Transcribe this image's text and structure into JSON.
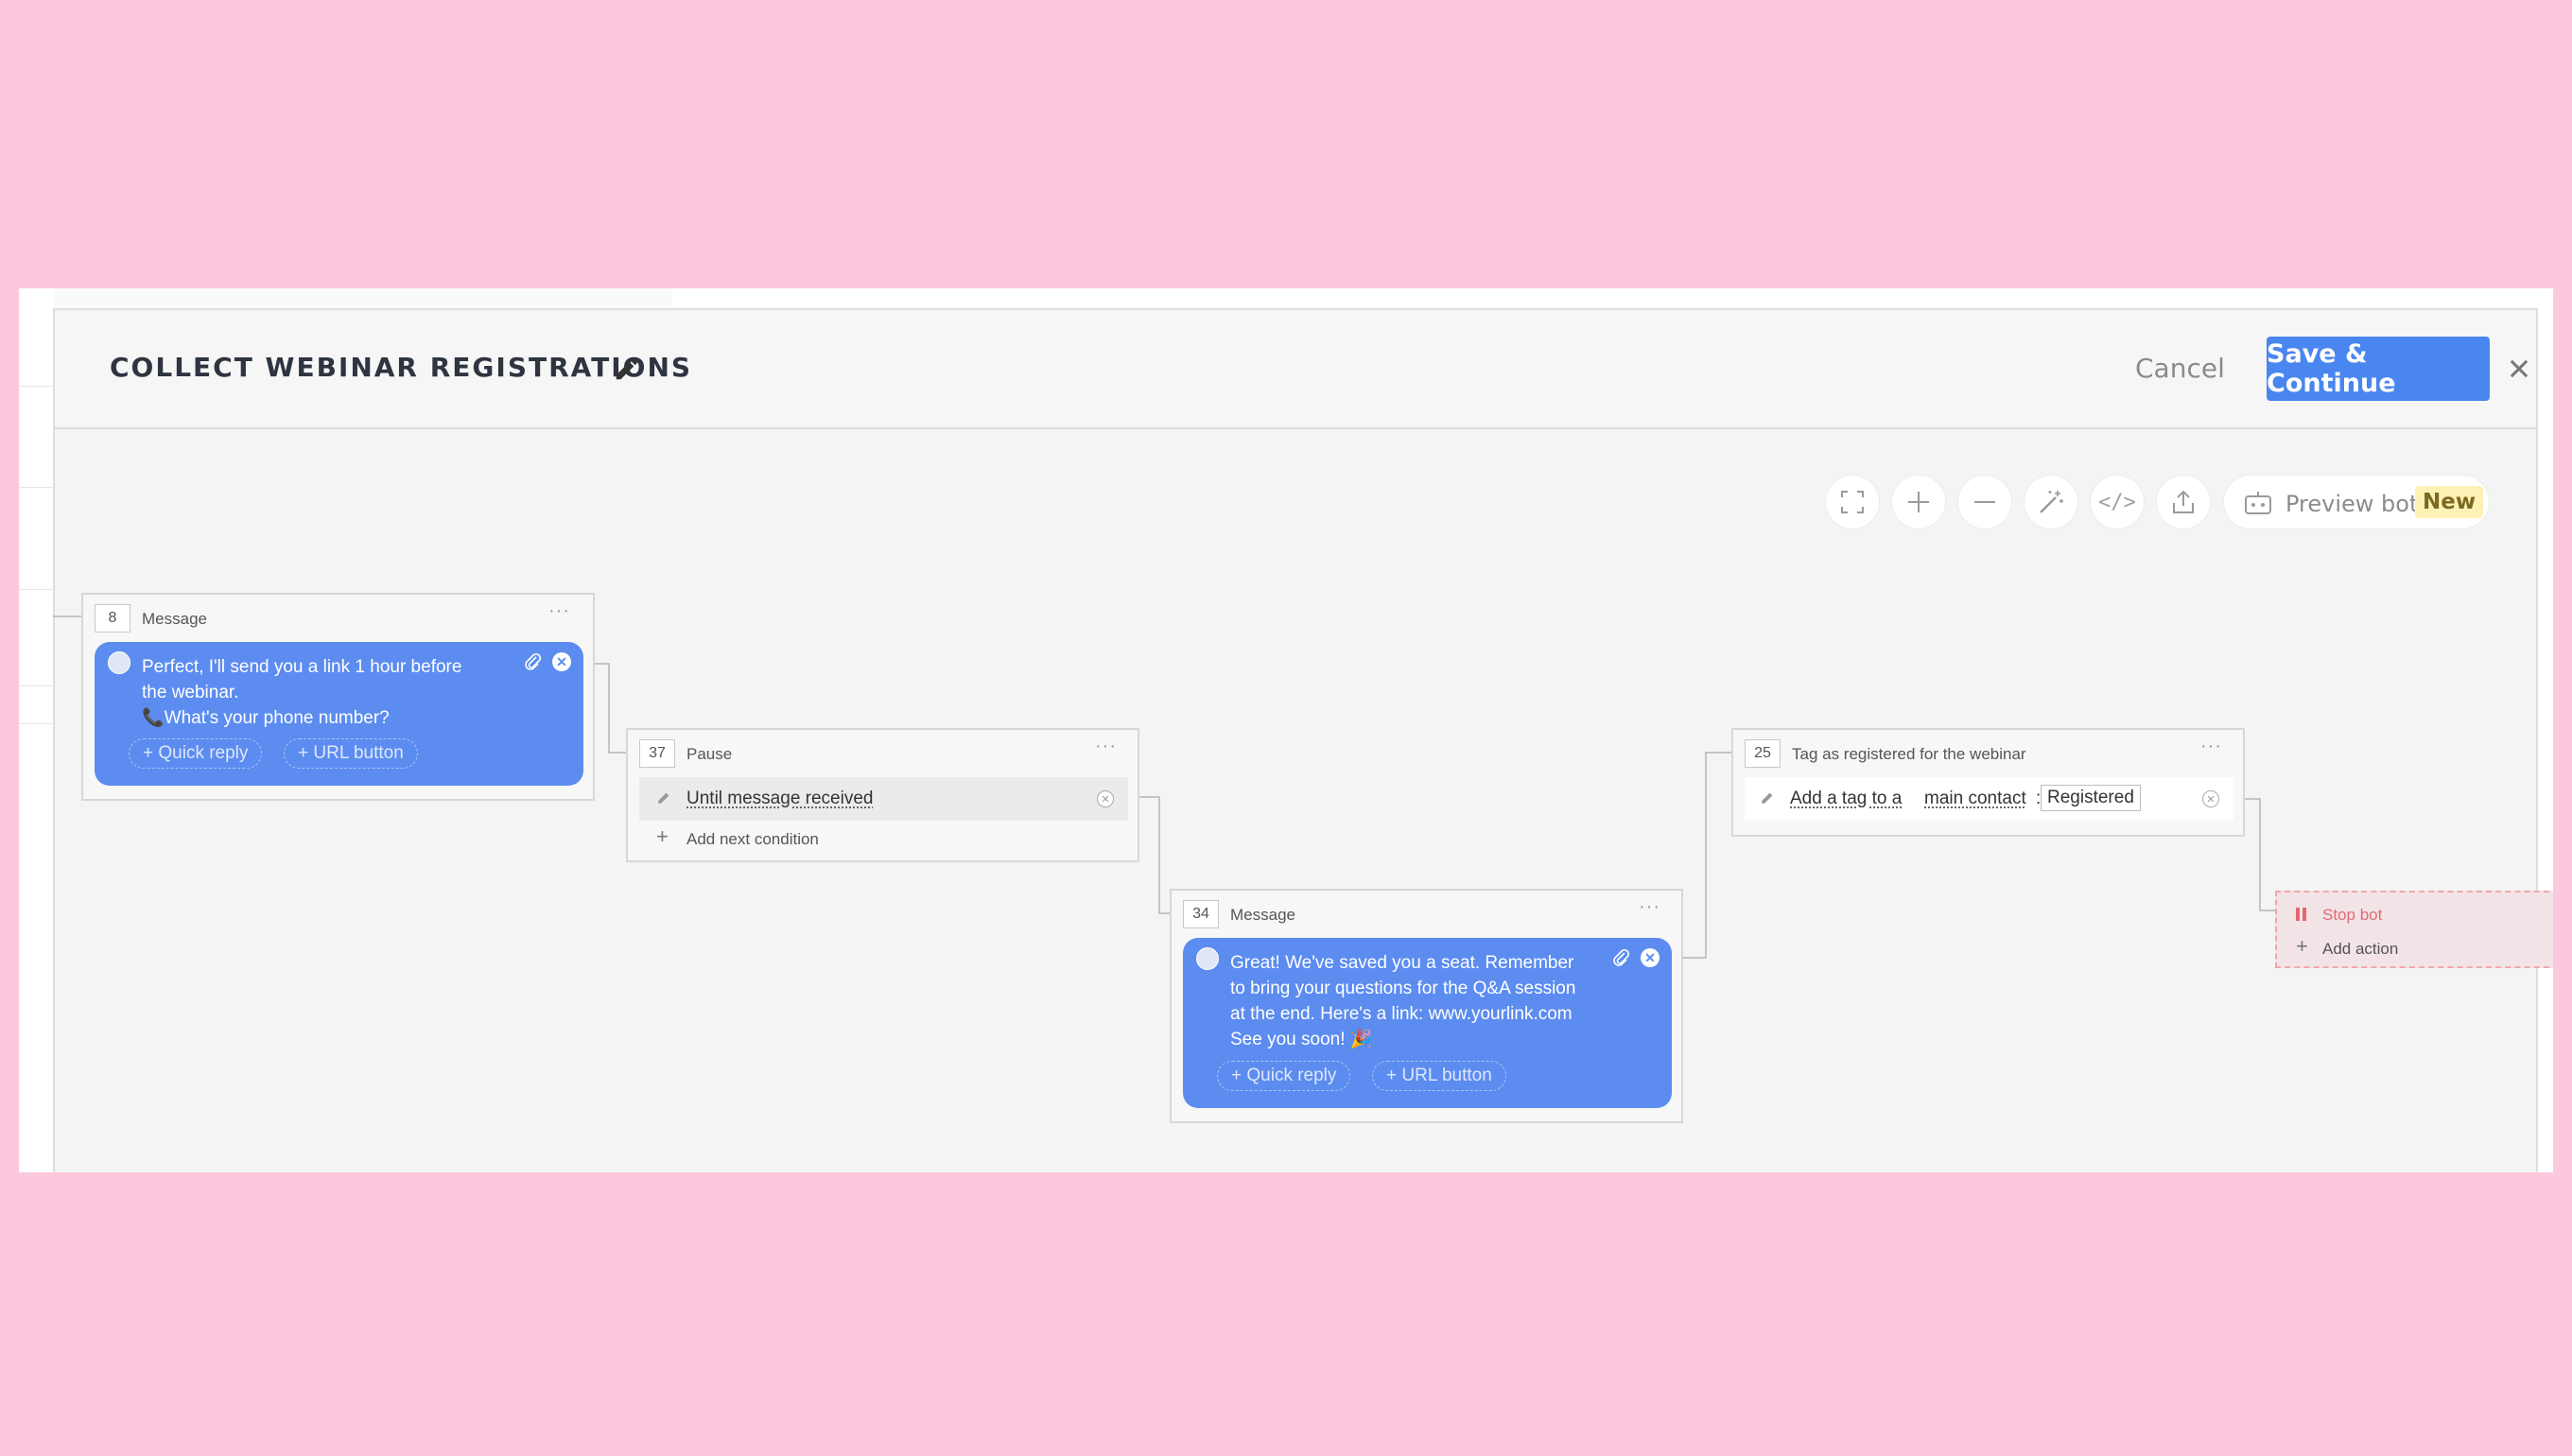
{
  "header": {
    "title": "COLLECT WEBINAR REGISTRATIONS",
    "cancel_label": "Cancel",
    "save_label": "Save & Continue"
  },
  "toolbar": {
    "tools": [
      "fullscreen-icon",
      "zoom-in-icon",
      "zoom-out-icon",
      "magic-wand-icon",
      "code-icon",
      "export-icon"
    ],
    "code_glyph": "</>",
    "preview_label": "Preview bot",
    "new_badge": "New"
  },
  "nodes": {
    "message1": {
      "number": "8",
      "type": "Message",
      "text": "Perfect, I'll send you a link 1 hour before\nthe webinar.\n📞What's your phone number?",
      "quick_reply": "+ Quick reply",
      "url_button": "+ URL button"
    },
    "pause": {
      "number": "37",
      "type": "Pause",
      "condition": "Until message received",
      "add_condition": "Add next condition"
    },
    "message2": {
      "number": "34",
      "type": "Message",
      "text": "Great! We've saved you a seat. Remember\nto bring your questions for the Q&A session\nat the end. Here's a link: www.yourlink.com\nSee you soon! 🎉",
      "quick_reply": "+ Quick reply",
      "url_button": "+ URL button"
    },
    "tag": {
      "number": "25",
      "type": "Tag as registered for the webinar",
      "action_prefix": "Add a tag to a",
      "action_target": "main contact",
      "action_colon": ":",
      "tag_value": "Registered"
    },
    "stop": {
      "label": "Stop bot",
      "add_action": "Add action"
    }
  },
  "colors": {
    "background": "#fcc8de",
    "accent": "#4a86f0",
    "bubble": "#5c8cef",
    "stop": "#e36872"
  }
}
